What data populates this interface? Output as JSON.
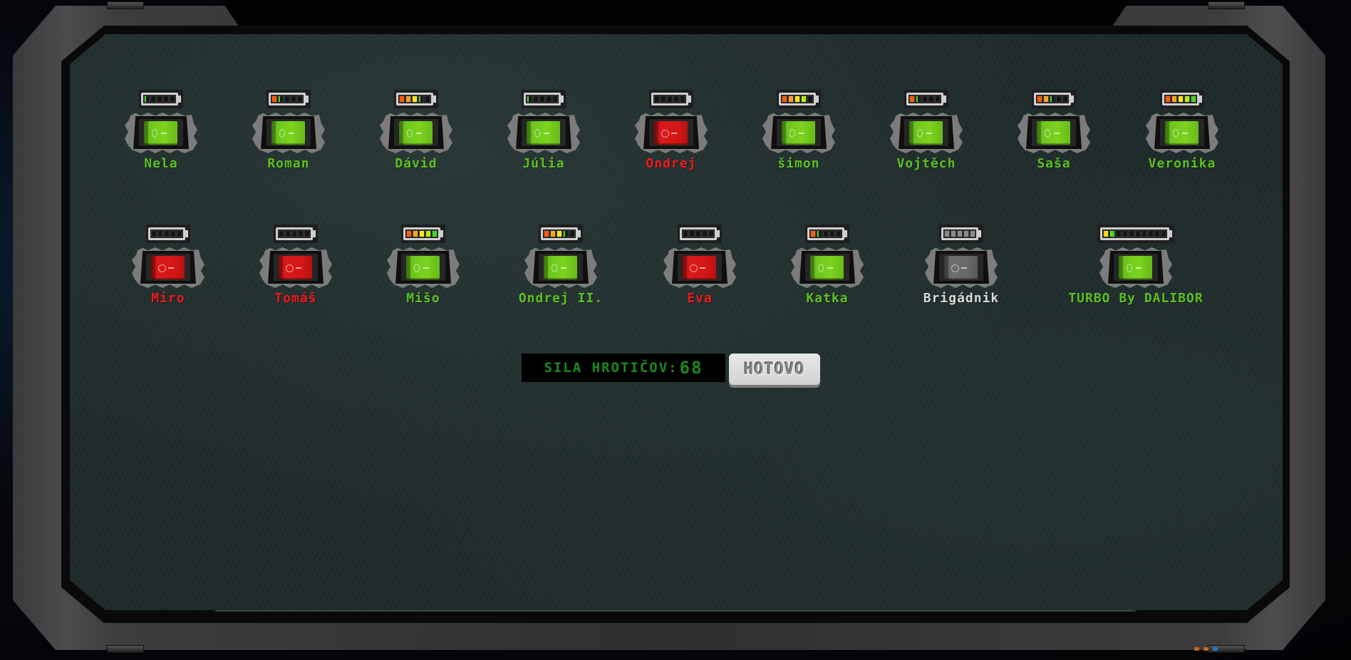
{
  "colors": {
    "name_on": "#5dc121",
    "name_off": "#ee1b1b",
    "name_disabled": "#d8d8d8",
    "strength_text": "#1b8a1b"
  },
  "employees_row1": [
    {
      "name": "Nela",
      "state": "on",
      "battery_segments": 5,
      "battery_level": 0.02
    },
    {
      "name": "Roman",
      "state": "on",
      "battery_segments": 5,
      "battery_level": 0.28
    },
    {
      "name": "Dávid",
      "state": "on",
      "battery_segments": 5,
      "battery_level": 0.66
    },
    {
      "name": "Júlia",
      "state": "on",
      "battery_segments": 5,
      "battery_level": 0.08
    },
    {
      "name": "Ondrej",
      "state": "off",
      "battery_segments": 5,
      "battery_level": 0
    },
    {
      "name": "šimon",
      "state": "on",
      "battery_segments": 5,
      "battery_level": 0.8
    },
    {
      "name": "Vojtěch",
      "state": "on",
      "battery_segments": 5,
      "battery_level": 0.26
    },
    {
      "name": "Saša",
      "state": "on",
      "battery_segments": 5,
      "battery_level": 0.44
    },
    {
      "name": "Veronika",
      "state": "on",
      "battery_segments": 5,
      "battery_level": 1.0
    }
  ],
  "employees_row2": [
    {
      "name": "Miro",
      "state": "off",
      "battery_segments": 5,
      "battery_level": 0
    },
    {
      "name": "Tomáš",
      "state": "off",
      "battery_segments": 5,
      "battery_level": 0
    },
    {
      "name": "Mišo",
      "state": "on",
      "battery_segments": 5,
      "battery_level": 1.0
    },
    {
      "name": "Ondrej II.",
      "state": "on",
      "battery_segments": 5,
      "battery_level": 0.66
    },
    {
      "name": "Eva",
      "state": "off",
      "battery_segments": 5,
      "battery_level": 0
    },
    {
      "name": "Katka",
      "state": "on",
      "battery_segments": 5,
      "battery_level": 0.26
    },
    {
      "name": "Brigádnik",
      "state": "disabled",
      "battery_segments": 5,
      "battery_level": 1.0
    },
    {
      "name": "TURBO By DALIBOR",
      "state": "on",
      "battery_segments": 10,
      "battery_level": 0.2
    }
  ],
  "strength": {
    "label": "SILA HROTIČOV:",
    "value": "68"
  },
  "done_button": {
    "label": "HOTOVO"
  }
}
